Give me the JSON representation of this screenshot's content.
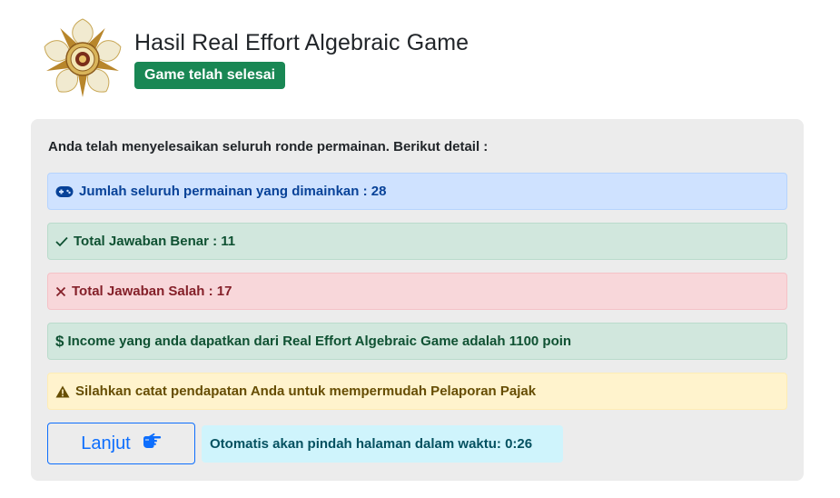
{
  "header": {
    "title": "Hasil Real Effort Algebraic Game",
    "badge": "Game telah selesai",
    "logo_icon": "university-emblem-icon"
  },
  "card": {
    "intro": "Anda telah menyelesaikan seluruh ronde permainan. Berikut detail :",
    "alerts": [
      {
        "icon": "gamepad-icon",
        "text": "Jumlah seluruh permainan yang dimainkan : 28",
        "variant": "primary"
      },
      {
        "icon": "check-icon",
        "text": "Total Jawaban Benar : 11",
        "variant": "success"
      },
      {
        "icon": "x-icon",
        "text": "Total Jawaban Salah : 17",
        "variant": "danger"
      },
      {
        "icon": "dollar-icon",
        "text": "Income yang anda dapatkan dari Real Effort Algebraic Game adalah 1100 poin",
        "variant": "success"
      },
      {
        "icon": "warning-icon",
        "text": "Silahkan catat pendapatan Anda untuk mempermudah Pelaporan Pajak",
        "variant": "warning"
      }
    ],
    "next_button": {
      "label": "Lanjut",
      "icon": "hand-point-right-icon"
    },
    "timer_text": "Otomatis akan pindah halaman dalam waktu: 0:26"
  },
  "colors": {
    "badge": "#198754",
    "primary": "#0d6efd",
    "card_bg": "#ececec"
  }
}
